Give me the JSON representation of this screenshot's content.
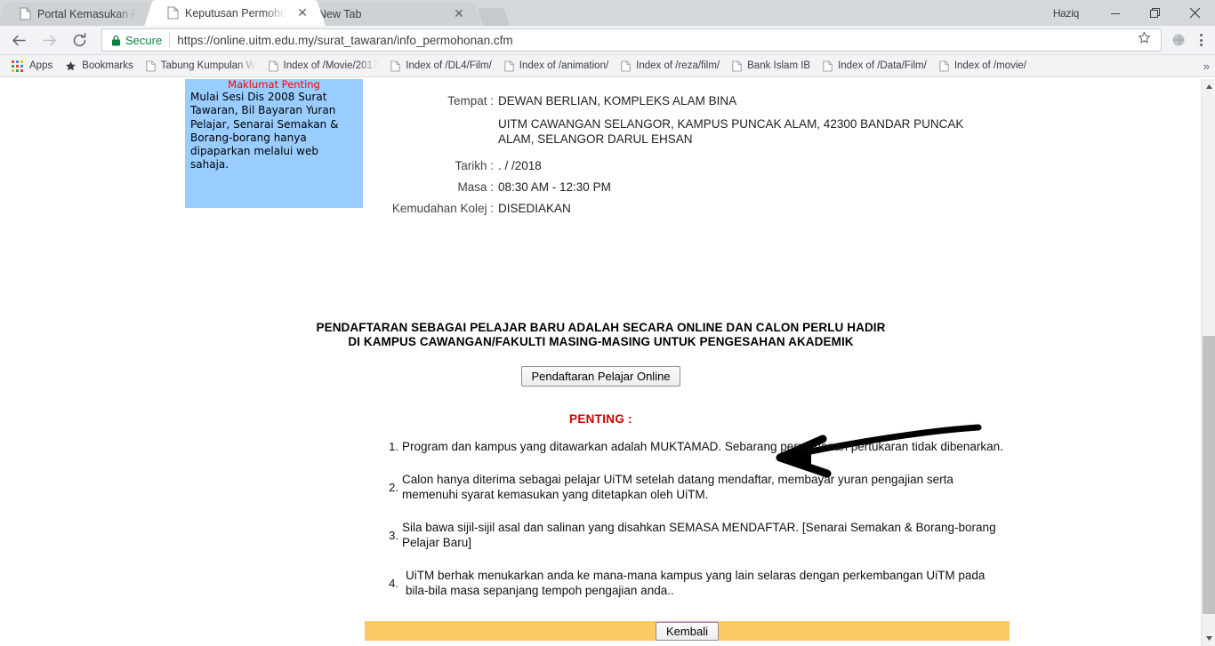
{
  "browser": {
    "profile_name": "Haziq",
    "tabs": [
      {
        "title": "Portal Kemasukan Pelajar",
        "active": false,
        "truncated": true,
        "icon": "page-icon",
        "close": "✕"
      },
      {
        "title": "Keputusan Permohonan",
        "active": true,
        "truncated": true,
        "icon": "page-icon",
        "close": "✕"
      },
      {
        "title": "New Tab",
        "active": false,
        "truncated": false,
        "icon": "",
        "close": "✕"
      }
    ],
    "window_controls": {
      "minimize": "─",
      "maximize": "❐",
      "close": "✕"
    },
    "nav": {
      "back": "←",
      "forward": "→",
      "reload": "⟳"
    },
    "omnibox": {
      "security_label": "Secure",
      "url": "https://online.uitm.edu.my/surat_tawaran/info_permohonan.cfm",
      "star": "☆"
    },
    "bookmarks": {
      "apps_label": "Apps",
      "items": [
        {
          "label": "Bookmarks",
          "icon": "star-icon",
          "truncated": false
        },
        {
          "label": "Tabung Kumpulan W",
          "icon": "page-icon",
          "truncated": true
        },
        {
          "label": "Index of /Movie/2017",
          "icon": "page-icon",
          "truncated": true
        },
        {
          "label": "Index of /DL4/Film/",
          "icon": "page-icon",
          "truncated": false
        },
        {
          "label": "Index of /animation/",
          "icon": "page-icon",
          "truncated": false
        },
        {
          "label": "Index of /reza/film/",
          "icon": "page-icon",
          "truncated": false
        },
        {
          "label": "Bank Islam IB",
          "icon": "page-icon",
          "truncated": false
        },
        {
          "label": "Index of /Data/Film/",
          "icon": "page-icon",
          "truncated": false
        },
        {
          "label": "Index of /movie/",
          "icon": "page-icon",
          "truncated": false
        }
      ],
      "overflow": "»"
    }
  },
  "page": {
    "infobox": {
      "title": "Maklumat Penting",
      "body": "Mulai Sesi Dis 2008 Surat Tawaran, Bil Bayaran Yuran Pelajar, Senarai Semakan & Borang-borang hanya dipaparkan melalui web sahaja.",
      "bg_color": "#99ccff",
      "title_color": "#ff0000"
    },
    "details": [
      {
        "label": "Tempat :",
        "value": "DEWAN BERLIAN, KOMPLEKS ALAM BINA",
        "sub": "UITM CAWANGAN SELANGOR, KAMPUS PUNCAK ALAM, 42300 BANDAR PUNCAK ALAM, SELANGOR DARUL EHSAN"
      },
      {
        "label": "Tarikh :",
        "value": ".  /   /2018",
        "sub": ""
      },
      {
        "label": "Masa :",
        "value": "08:30 AM - 12:30 PM",
        "sub": ""
      },
      {
        "label": "Kemudahan Kolej :",
        "value": "DISEDIAKAN",
        "sub": ""
      }
    ],
    "headline_line1": "PENDAFTARAN SEBAGAI PELAJAR BARU ADALAH SECARA ONLINE DAN CALON PERLU HADIR",
    "headline_line2": "DI KAMPUS CAWANGAN/FAKULTI MASING-MASING UNTUK PENGESAHAN AKADEMIK",
    "register_button": "Pendaftaran Pelajar Online",
    "penting_title": "PENTING :",
    "penting_color": "#cc0000",
    "notes": [
      {
        "num": "1.",
        "text": "Program dan kampus yang ditawarkan adalah MUKTAMAD. Sebarang permohonan pertukaran tidak dibenarkan."
      },
      {
        "num": "2.",
        "text": "Calon hanya diterima sebagai pelajar UiTM setelah datang mendaftar, membayar yuran pengajian serta memenuhi syarat kemasukan yang ditetapkan oleh UiTM."
      },
      {
        "num": "3.",
        "text": "Sila bawa sijil-sijil asal dan salinan yang disahkan SEMASA MENDAFTAR. [Senarai Semakan & Borang-borang Pelajar Baru]"
      },
      {
        "num": "4.",
        "text": "UiTM berhak menukarkan anda ke mana-mana kampus yang lain selaras dengan perkembangan UiTM pada bila-bila masa sepanjang tempoh pengajian anda.."
      }
    ],
    "back_button": "Kembali",
    "bottom_bar_color": "#fcc963",
    "annotation": "curved-arrow-pointing-left-to-register-button"
  },
  "scrollbar": {
    "up": "▲",
    "down": "▼"
  }
}
